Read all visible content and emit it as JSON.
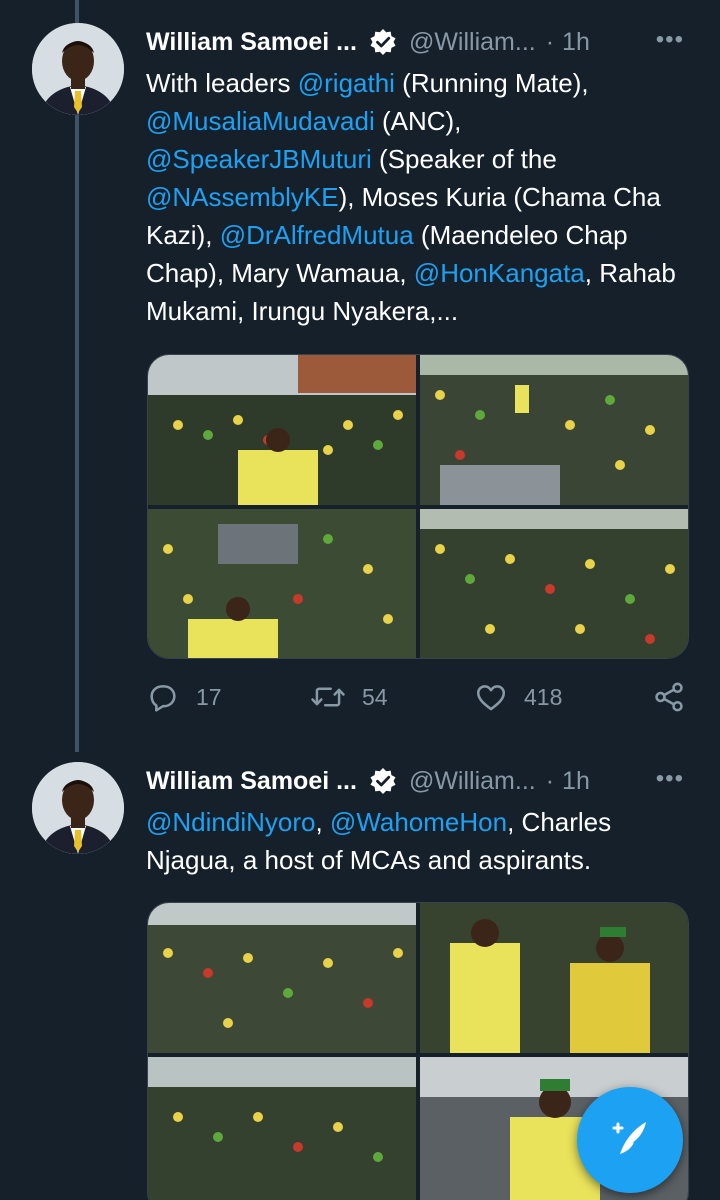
{
  "tweets": [
    {
      "author_name": "William Samoei ...",
      "handle": "@William...",
      "dot": "·",
      "time": "1h",
      "more": "•••",
      "text": [
        {
          "t": "With leaders ",
          "m": false
        },
        {
          "t": "@rigathi",
          "m": true
        },
        {
          "t": " (Running Mate), ",
          "m": false
        },
        {
          "t": "@MusaliaMudavadi",
          "m": true
        },
        {
          "t": " (ANC), ",
          "m": false
        },
        {
          "t": "@SpeakerJBMuturi",
          "m": true
        },
        {
          "t": " (Speaker of the ",
          "m": false
        },
        {
          "t": "@NAssemblyKE",
          "m": true
        },
        {
          "t": "), Moses Kuria (Chama Cha Kazi), ",
          "m": false
        },
        {
          "t": "@DrAlfredMutua",
          "m": true
        },
        {
          "t": " (Maendeleo Chap Chap), Mary Wamaua, ",
          "m": false
        },
        {
          "t": "@HonKangata",
          "m": true
        },
        {
          "t": ", Rahab Mukami, Irungu Nyakera,...",
          "m": false
        }
      ],
      "actions": {
        "reply_count": "17",
        "retweet_count": "54",
        "like_count": "418"
      }
    },
    {
      "author_name": "William Samoei ...",
      "handle": "@William...",
      "dot": "·",
      "time": "1h",
      "more": "•••",
      "text": [
        {
          "t": "@NdindiNyoro",
          "m": true
        },
        {
          "t": ", ",
          "m": false
        },
        {
          "t": "@WahomeHon",
          "m": true
        },
        {
          "t": ", Charles Njagua, a host of MCAs and aspirants.",
          "m": false
        }
      ]
    }
  ],
  "icons": {
    "verified": "verified-badge-icon",
    "reply": "reply-icon",
    "retweet": "retweet-icon",
    "like": "heart-icon",
    "share": "share-icon",
    "compose": "compose-tweet-icon"
  },
  "colors": {
    "background": "#15202b",
    "accent": "#1da1f2",
    "muted": "#8899a6",
    "thread_line": "#3d5466"
  }
}
